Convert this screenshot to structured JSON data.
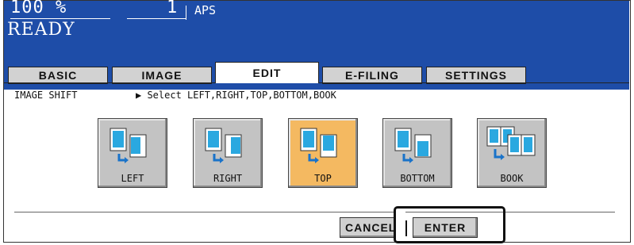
{
  "header": {
    "zoom": "100  %",
    "copies": "1",
    "paper": "APS",
    "status": "READY",
    "bg_color": "#1e4da8"
  },
  "tabs": [
    {
      "label": "BASIC",
      "active": false
    },
    {
      "label": "IMAGE",
      "active": false
    },
    {
      "label": "EDIT",
      "active": true
    },
    {
      "label": "E-FILING",
      "active": false
    },
    {
      "label": "SETTINGS",
      "active": false
    }
  ],
  "section": {
    "title": "IMAGE SHIFT",
    "instruction": "▶ Select LEFT,RIGHT,TOP,BOTTOM,BOOK"
  },
  "options": [
    {
      "label": "LEFT",
      "icon": "shift-left-icon",
      "selected": false
    },
    {
      "label": "RIGHT",
      "icon": "shift-right-icon",
      "selected": false
    },
    {
      "label": "TOP",
      "icon": "shift-top-icon",
      "selected": true
    },
    {
      "label": "BOTTOM",
      "icon": "shift-bottom-icon",
      "selected": false
    },
    {
      "label": "BOOK",
      "icon": "shift-book-icon",
      "selected": false
    }
  ],
  "actions": {
    "cancel_label": "CANCEL",
    "enter_label": "ENTER"
  },
  "colors": {
    "selected": "#f4b961",
    "button": "#c3c3c3",
    "page_fill": "#2aa8e0"
  }
}
